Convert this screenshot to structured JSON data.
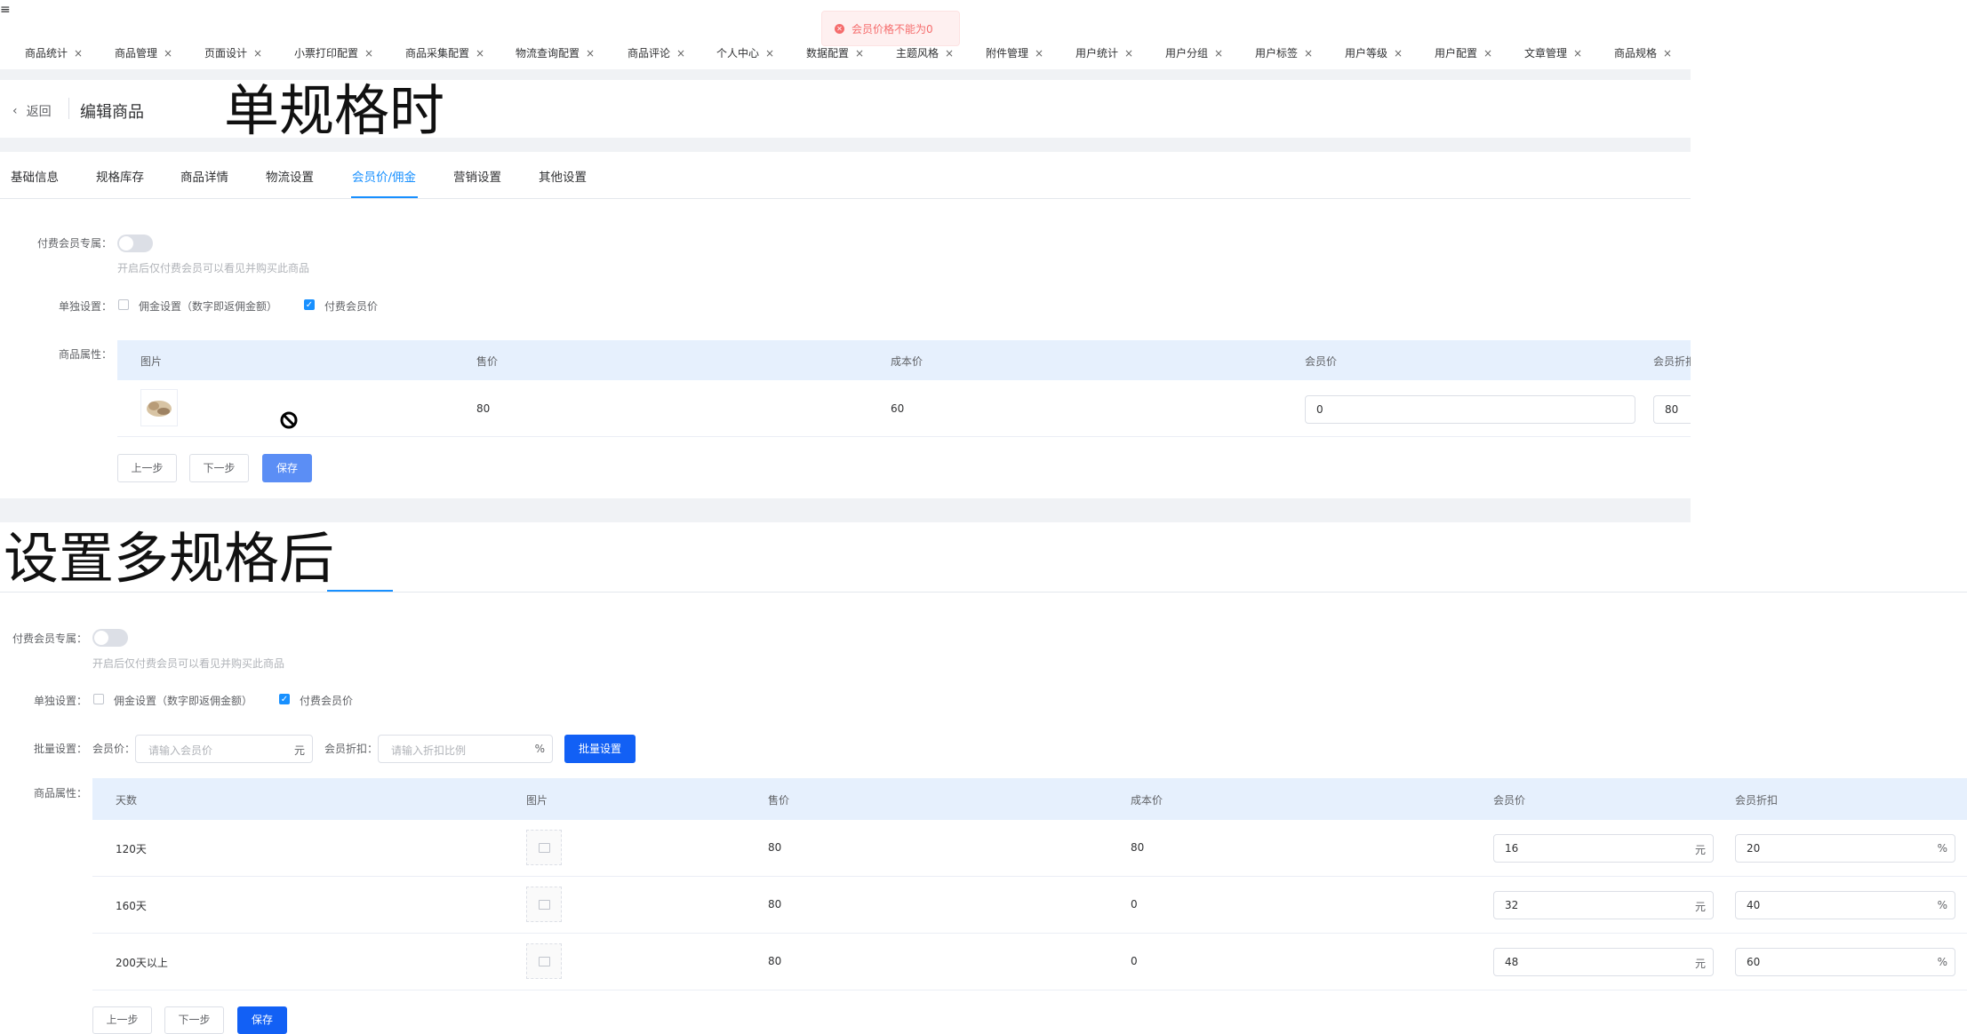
{
  "topbar": {
    "menu_glyph": "≡"
  },
  "tabs": [
    {
      "label": "商品统计"
    },
    {
      "label": "商品管理"
    },
    {
      "label": "页面设计"
    },
    {
      "label": "小票打印配置"
    },
    {
      "label": "商品采集配置"
    },
    {
      "label": "物流查询配置"
    },
    {
      "label": "商品评论"
    },
    {
      "label": "个人中心"
    },
    {
      "label": "数据配置"
    },
    {
      "label": "主题风格"
    },
    {
      "label": "附件管理"
    },
    {
      "label": "用户统计"
    },
    {
      "label": "用户分组"
    },
    {
      "label": "用户标签"
    },
    {
      "label": "用户等级"
    },
    {
      "label": "用户配置"
    },
    {
      "label": "文章管理"
    },
    {
      "label": "商品规格"
    }
  ],
  "tab_close": "×",
  "toast": {
    "message": "会员价格不能为0",
    "icon": "error-circle-icon",
    "color": "#f56c6c"
  },
  "header": {
    "back": "返回",
    "title": "编辑商品"
  },
  "annotations": {
    "single": "单规格时",
    "multi": "设置多规格后"
  },
  "sub_tabs": [
    "基础信息",
    "规格库存",
    "商品详情",
    "物流设置",
    "会员价/佣金",
    "营销设置",
    "其他设置"
  ],
  "active_sub_tab": "会员价/佣金",
  "form": {
    "paid_member_label": "付费会员专属：",
    "paid_member_hint": "开启后仅付费会员可以看见并购买此商品",
    "separate_label": "单独设置：",
    "commission_option": "佣金设置（数字即返佣金额）",
    "member_price_option": "付费会员价",
    "attr_label": "商品属性："
  },
  "single_table": {
    "headers": [
      "图片",
      "售价",
      "成本价",
      "会员价",
      "会员折扣"
    ],
    "row": {
      "price": "80",
      "cost": "60",
      "member_price": "0",
      "discount": "80"
    }
  },
  "buttons": {
    "prev": "上一步",
    "next": "下一步",
    "save": "保存",
    "batch": "批量设置"
  },
  "batch": {
    "label": "批量设置：",
    "member_price_label": "会员价：",
    "member_price_placeholder": "请输入会员价",
    "member_price_unit": "元",
    "discount_label": "会员折扣：",
    "discount_placeholder": "请输入折扣比例",
    "discount_unit": "%"
  },
  "multi_table": {
    "headers": [
      "天数",
      "图片",
      "售价",
      "成本价",
      "会员价",
      "会员折扣"
    ],
    "rows": [
      {
        "days": "120天",
        "price": "80",
        "cost": "80",
        "member_price": "16",
        "discount": "20"
      },
      {
        "days": "160天",
        "price": "80",
        "cost": "0",
        "member_price": "32",
        "discount": "40"
      },
      {
        "days": "200天以上",
        "price": "80",
        "cost": "0",
        "member_price": "48",
        "discount": "60"
      }
    ],
    "unit_yuan": "元",
    "unit_percent": "%"
  },
  "colors": {
    "accent": "#1890ff",
    "primary_button": "#1260f5",
    "error": "#f56c6c"
  }
}
